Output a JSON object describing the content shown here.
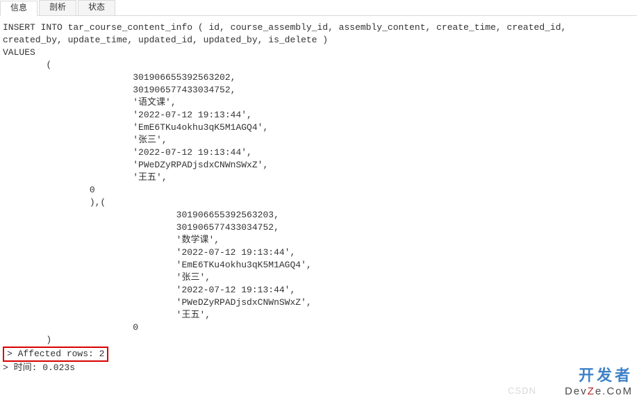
{
  "tabs": {
    "info": "信息",
    "profile": "剖析",
    "status": "状态"
  },
  "sql": {
    "header": "INSERT INTO tar_course_content_info ( id, course_assembly_id, assembly_content, create_time, created_id,\ncreated_by, update_time, updated_id, updated_by, is_delete )\nVALUES\n        (",
    "r1_id": "                        301906655392563202,",
    "r1_course": "                        301906577433034752,",
    "r1_assembly_content": "                        '语文课',",
    "r1_create_time": "                        '2022-07-12 19:13:44',",
    "r1_created_id": "                        'EmE6TKu4okhu3qK5M1AGQ4',",
    "r1_created_by": "                        '张三',",
    "r1_update_time": "                        '2022-07-12 19:13:44',",
    "r1_updated_id": "                        'PWeDZyRPADjsdxCNWnSWxZ',",
    "r1_updated_by": "                        '王五',",
    "r1_is_delete": "                0",
    "between": "                ),(",
    "r2_id": "                                301906655392563203,",
    "r2_course": "                                301906577433034752,",
    "r2_assembly_content": "                                '数学课',",
    "r2_create_time": "                                '2022-07-12 19:13:44',",
    "r2_created_id": "                                'EmE6TKu4okhu3qK5M1AGQ4',",
    "r2_created_by": "                                '张三',",
    "r2_update_time": "                                '2022-07-12 19:13:44',",
    "r2_updated_id": "                                'PWeDZyRPADjsdxCNWnSWxZ',",
    "r2_updated_by": "                                '王五',",
    "r2_is_delete": "                        0",
    "close": "        )"
  },
  "result": {
    "affected": "> Affected rows: 2",
    "time": "> 时间: 0.023s"
  },
  "watermark": {
    "csdn": "CSDN",
    "brand_cn": "开发者",
    "brand_en_pre": "Dev",
    "brand_en_z": "Z",
    "brand_en_post": "e.CoM"
  }
}
